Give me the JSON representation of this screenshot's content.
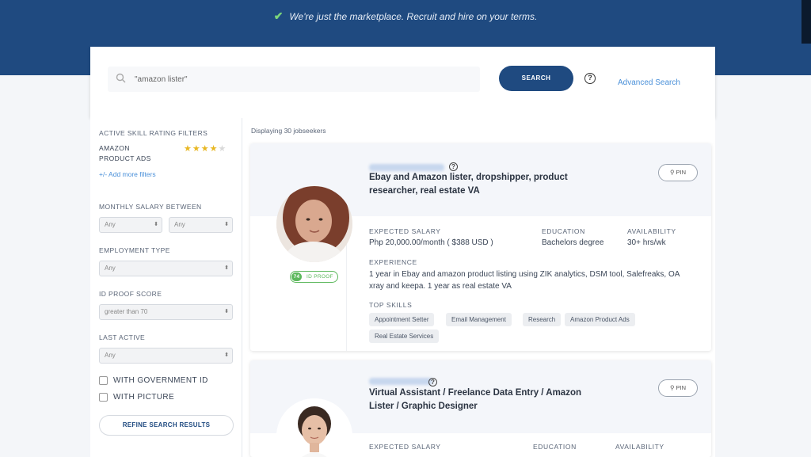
{
  "banner": {
    "tagline": "We're just the marketplace. Recruit and hire on your terms.",
    "background_color": "#1f4a80"
  },
  "search": {
    "query": "\"amazon lister\"",
    "search_label": "SEARCH",
    "advanced_label": "Advanced Search",
    "help_icon": "question-circle-icon"
  },
  "sidebar": {
    "active_filters_heading": "ACTIVE SKILL RATING FILTERS",
    "skill_filter": {
      "name": "AMAZON PRODUCT ADS",
      "rating": 4,
      "max_rating": 5
    },
    "add_filters_label": "+/- Add more filters",
    "salary_heading": "MONTHLY SALARY BETWEEN",
    "salary_min": "Any",
    "salary_max": "Any",
    "employment_heading": "EMPLOYMENT TYPE",
    "employment_value": "Any",
    "id_proof_heading": "ID PROOF SCORE",
    "id_proof_value": "greater than 70",
    "last_active_heading": "LAST ACTIVE",
    "last_active_value": "Any",
    "with_gov_id_label": "WITH GOVERNMENT ID",
    "with_picture_label": "WITH PICTURE",
    "refine_label": "REFINE SEARCH RESULTS"
  },
  "results": {
    "displaying_text": "Displaying 30 jobseekers",
    "cards": [
      {
        "title": "Ebay and Amazon lister, dropshipper, product researcher, real estate VA",
        "pin_label": "PIN",
        "expected_salary_label": "EXPECTED SALARY",
        "expected_salary": "Php 20,000.00/month ( $388 USD )",
        "education_label": "EDUCATION",
        "education": "Bachelors degree",
        "availability_label": "AVAILABILITY",
        "availability": "30+ hrs/wk",
        "experience_label": "EXPERIENCE",
        "experience": "1 year in Ebay and amazon product listing using ZIK analytics, DSM tool, Salefreaks, OA xray and keepa. 1 year as real estate VA",
        "top_skills_label": "TOP SKILLS",
        "skills": [
          "Appointment Setter",
          "Email Management",
          "Research",
          "Amazon Product Ads",
          "Real Estate Services"
        ],
        "id_proof_score": "74",
        "id_proof_label": "ID PROOF"
      },
      {
        "title": "Virtual Assistant / Freelance Data Entry / Amazon Lister / Graphic Designer",
        "pin_label": "PIN",
        "expected_salary_label": "EXPECTED SALARY",
        "education_label": "EDUCATION",
        "availability_label": "AVAILABILITY"
      }
    ]
  }
}
